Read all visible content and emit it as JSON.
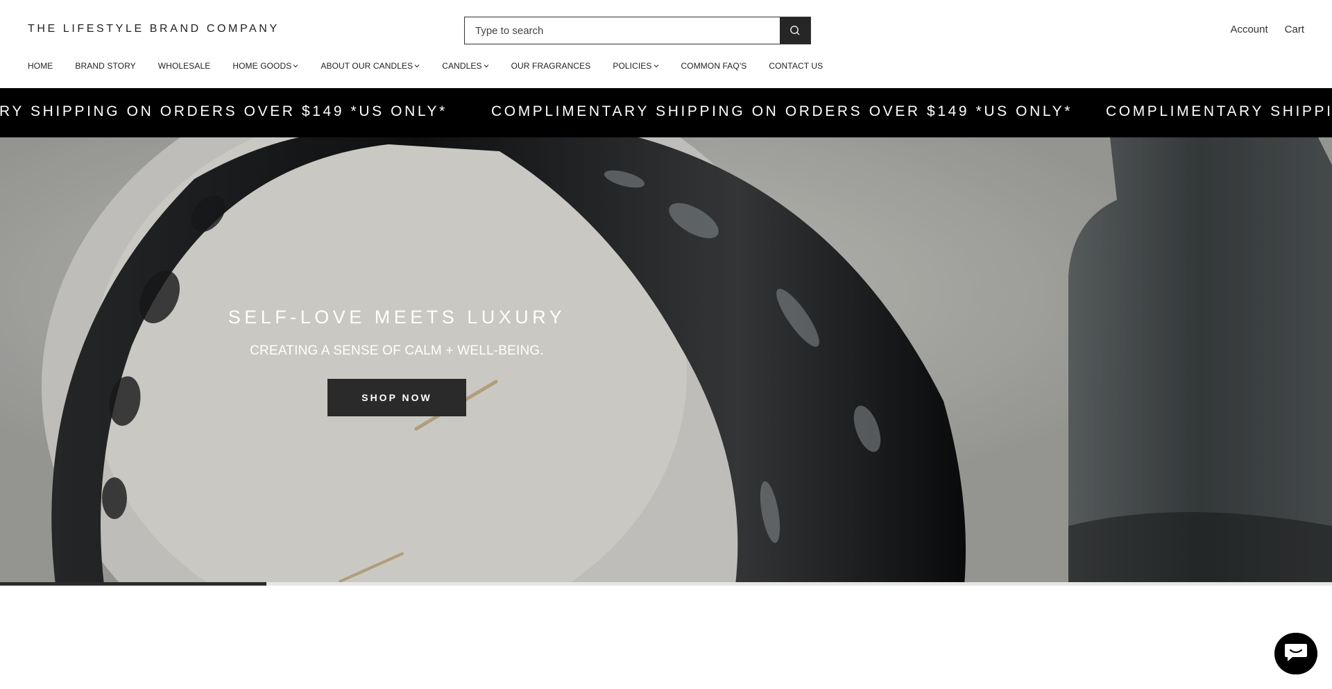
{
  "header": {
    "brand": "THE LIFESTYLE BRAND COMPANY",
    "search": {
      "placeholder": "Type to search",
      "icon": "search-icon"
    },
    "account_label": "Account",
    "cart_label": "Cart"
  },
  "nav": {
    "items": [
      {
        "label": "HOME",
        "has_dropdown": false
      },
      {
        "label": "BRAND STORY",
        "has_dropdown": false
      },
      {
        "label": "WHOLESALE",
        "has_dropdown": false
      },
      {
        "label": "HOME GOODS",
        "has_dropdown": true
      },
      {
        "label": "ABOUT OUR CANDLES",
        "has_dropdown": true
      },
      {
        "label": "CANDLES",
        "has_dropdown": true
      },
      {
        "label": "OUR FRAGRANCES",
        "has_dropdown": false
      },
      {
        "label": "POLICIES",
        "has_dropdown": true
      },
      {
        "label": "COMMON FAQ'S",
        "has_dropdown": false
      },
      {
        "label": "CONTACT US",
        "has_dropdown": false
      }
    ]
  },
  "announcement": {
    "text": "COMPLIMENTARY SHIPPING ON ORDERS OVER $149 *US ONLY*",
    "visible_fragments": [
      "RY SHIPPING ON ORDERS OVER $149 *US ONLY*",
      "COMPLIMENTARY SHIPPING ON ORDERS OVER $149 *US ONLY*",
      "COMPLIMENTARY SHIPPIN"
    ]
  },
  "hero": {
    "title": "SELF-LOVE MEETS LUXURY",
    "subtitle": "CREATING A SENSE OF CALM + WELL-BEING.",
    "cta_label": "SHOP NOW",
    "slide_progress": 0.2
  },
  "chat": {
    "icon": "chat-icon"
  },
  "colors": {
    "announce_bg": "#000000",
    "button_bg": "#2a2a2a",
    "text": "#222222"
  }
}
